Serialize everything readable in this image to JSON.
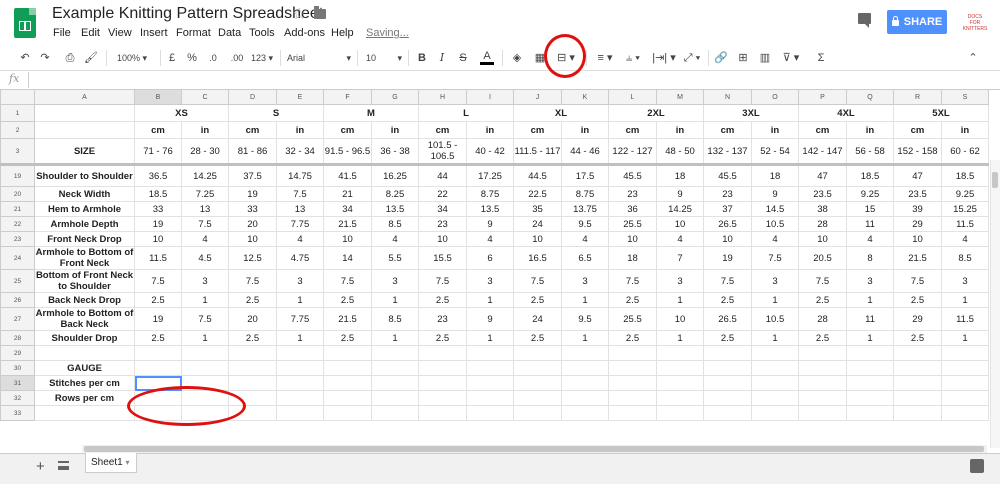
{
  "app": {
    "title": "Example Knitting Pattern Spreadsheet",
    "saving": "Saving...",
    "menu": [
      "File",
      "Edit",
      "View",
      "Insert",
      "Format",
      "Data",
      "Tools",
      "Add-ons",
      "Help"
    ],
    "share": "SHARE",
    "account_text": "DOCS FOR KNITTERS"
  },
  "toolbar": {
    "zoom": "100%",
    "currency": "£",
    "percent": "%",
    "dec_less": ".0",
    "dec_more": ".00",
    "format_more": "123",
    "font": "Arial",
    "font_size": "10",
    "bold": "B",
    "italic": "I",
    "strike": "S",
    "text_color": "A",
    "sum": "Σ"
  },
  "formula_bar": {
    "fx": "fx",
    "value": ""
  },
  "sheet": {
    "col_letters": [
      "A",
      "B",
      "C",
      "D",
      "E",
      "F",
      "G",
      "H",
      "I",
      "J",
      "K",
      "L",
      "M",
      "N",
      "O",
      "P",
      "Q",
      "R",
      "S"
    ],
    "sizes": [
      "XS",
      "S",
      "M",
      "L",
      "XL",
      "2XL",
      "3XL",
      "4XL",
      "5XL"
    ],
    "unit_cm": "cm",
    "unit_in": "in",
    "size_label": "SIZE",
    "row3": [
      "71 - 76",
      "28 - 30",
      "81 - 86",
      "32 - 34",
      "91.5 - 96.5",
      "36 - 38",
      "101.5 - 106.5",
      "40 - 42",
      "111.5 - 117",
      "44 - 46",
      "122 - 127",
      "48 - 50",
      "132 - 137",
      "52 - 54",
      "142 - 147",
      "56 - 58",
      "152 - 158",
      "60 - 62"
    ],
    "rows": [
      {
        "num": "19",
        "label": "Shoulder to Shoulder",
        "vals": [
          "36.5",
          "14.25",
          "37.5",
          "14.75",
          "41.5",
          "16.25",
          "44",
          "17.25",
          "44.5",
          "17.5",
          "45.5",
          "18",
          "45.5",
          "18",
          "47",
          "18.5",
          "47",
          "18.5"
        ]
      },
      {
        "num": "20",
        "label": "Neck Width",
        "vals": [
          "18.5",
          "7.25",
          "19",
          "7.5",
          "21",
          "8.25",
          "22",
          "8.75",
          "22.5",
          "8.75",
          "23",
          "9",
          "23",
          "9",
          "23.5",
          "9.25",
          "23.5",
          "9.25"
        ]
      },
      {
        "num": "21",
        "label": "Hem to Armhole",
        "vals": [
          "33",
          "13",
          "33",
          "13",
          "34",
          "13.5",
          "34",
          "13.5",
          "35",
          "13.75",
          "36",
          "14.25",
          "37",
          "14.5",
          "38",
          "15",
          "39",
          "15.25"
        ]
      },
      {
        "num": "22",
        "label": "Armhole Depth",
        "vals": [
          "19",
          "7.5",
          "20",
          "7.75",
          "21.5",
          "8.5",
          "23",
          "9",
          "24",
          "9.5",
          "25.5",
          "10",
          "26.5",
          "10.5",
          "28",
          "11",
          "29",
          "11.5"
        ]
      },
      {
        "num": "23",
        "label": "Front Neck Drop",
        "vals": [
          "10",
          "4",
          "10",
          "4",
          "10",
          "4",
          "10",
          "4",
          "10",
          "4",
          "10",
          "4",
          "10",
          "4",
          "10",
          "4",
          "10",
          "4"
        ]
      },
      {
        "num": "24",
        "label": "Armhole to Bottom of Front Neck",
        "vals": [
          "11.5",
          "4.5",
          "12.5",
          "4.75",
          "14",
          "5.5",
          "15.5",
          "6",
          "16.5",
          "6.5",
          "18",
          "7",
          "19",
          "7.5",
          "20.5",
          "8",
          "21.5",
          "8.5"
        ]
      },
      {
        "num": "25",
        "label": "Bottom of Front Neck to Shoulder",
        "vals": [
          "7.5",
          "3",
          "7.5",
          "3",
          "7.5",
          "3",
          "7.5",
          "3",
          "7.5",
          "3",
          "7.5",
          "3",
          "7.5",
          "3",
          "7.5",
          "3",
          "7.5",
          "3"
        ]
      },
      {
        "num": "26",
        "label": "Back Neck Drop",
        "vals": [
          "2.5",
          "1",
          "2.5",
          "1",
          "2.5",
          "1",
          "2.5",
          "1",
          "2.5",
          "1",
          "2.5",
          "1",
          "2.5",
          "1",
          "2.5",
          "1",
          "2.5",
          "1"
        ]
      },
      {
        "num": "27",
        "label": "Armhole to Bottom of Back Neck",
        "vals": [
          "19",
          "7.5",
          "20",
          "7.75",
          "21.5",
          "8.5",
          "23",
          "9",
          "24",
          "9.5",
          "25.5",
          "10",
          "26.5",
          "10.5",
          "28",
          "11",
          "29",
          "11.5"
        ]
      },
      {
        "num": "28",
        "label": "Shoulder Drop",
        "vals": [
          "2.5",
          "1",
          "2.5",
          "1",
          "2.5",
          "1",
          "2.5",
          "1",
          "2.5",
          "1",
          "2.5",
          "1",
          "2.5",
          "1",
          "2.5",
          "1",
          "2.5",
          "1"
        ]
      },
      {
        "num": "29",
        "label": "",
        "vals": []
      },
      {
        "num": "30",
        "label": "GAUGE",
        "vals": []
      },
      {
        "num": "31",
        "label": "Stitches per cm",
        "vals": []
      },
      {
        "num": "32",
        "label": "Rows per cm",
        "vals": []
      },
      {
        "num": "33",
        "label": "",
        "vals": []
      }
    ],
    "tab": "Sheet1"
  }
}
